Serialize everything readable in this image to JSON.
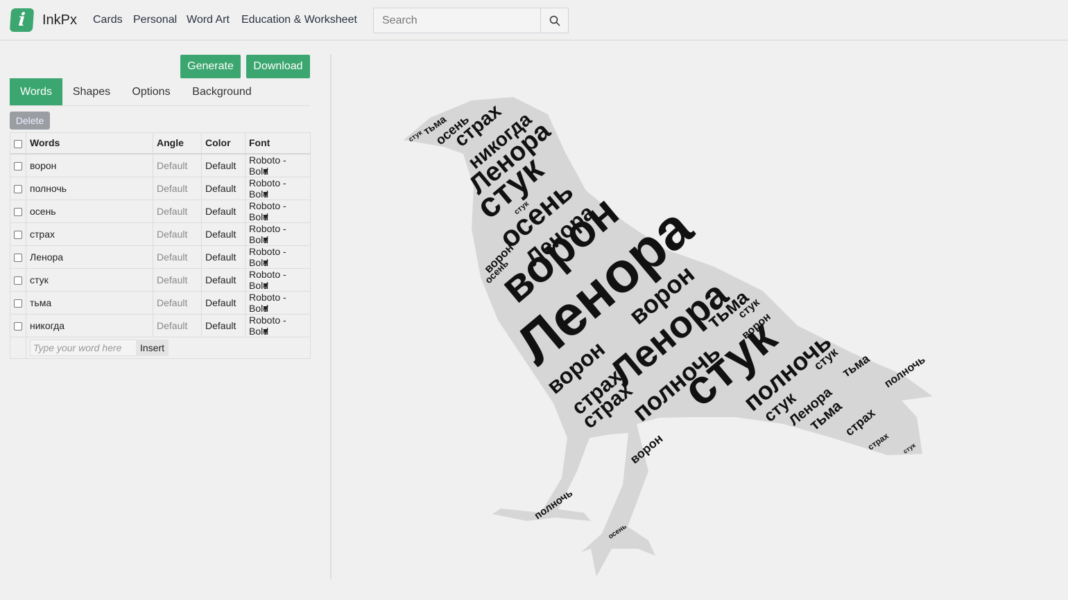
{
  "brand": "InkPx",
  "nav": [
    "Cards",
    "Personal",
    "Word Art",
    "Education & Worksheet"
  ],
  "search": {
    "placeholder": "Search",
    "icon": "search-icon"
  },
  "actions": {
    "generate": "Generate",
    "download": "Download"
  },
  "tabs": [
    "Words",
    "Shapes",
    "Options",
    "Background"
  ],
  "active_tab": "Words",
  "delete_label": "Delete",
  "table": {
    "headers": [
      "Words",
      "Angle",
      "Color",
      "Font"
    ],
    "rows": [
      {
        "word": "ворон",
        "angle": "Default",
        "color": "Default",
        "font": "Roboto - Bold"
      },
      {
        "word": "полночь",
        "angle": "Default",
        "color": "Default",
        "font": "Roboto - Bold"
      },
      {
        "word": "осень",
        "angle": "Default",
        "color": "Default",
        "font": "Roboto - Bold"
      },
      {
        "word": "страх",
        "angle": "Default",
        "color": "Default",
        "font": "Roboto - Bold"
      },
      {
        "word": "Ленора",
        "angle": "Default",
        "color": "Default",
        "font": "Roboto - Bold"
      },
      {
        "word": "стук",
        "angle": "Default",
        "color": "Default",
        "font": "Roboto - Bold"
      },
      {
        "word": "тьма",
        "angle": "Default",
        "color": "Default",
        "font": "Roboto - Bold"
      },
      {
        "word": "никогда",
        "angle": "Default",
        "color": "Default",
        "font": "Roboto - Bold"
      }
    ],
    "new_word_placeholder": "Type your word here",
    "insert_label": "Insert"
  },
  "cloud": {
    "shape_color": "#d6d6d6",
    "words": [
      "стук",
      "тьма",
      "осень",
      "страх",
      "никогда",
      "Ленора",
      "стук",
      "стук",
      "осень",
      "Ленора",
      "ворон",
      "ворон",
      "осень",
      "Ленора",
      "ворон",
      "Ленора",
      "ворон",
      "тьма",
      "ворон",
      "страх",
      "полночь",
      "стук",
      "полночь",
      "страх",
      "стук",
      "Ленора",
      "тьма",
      "стук",
      "страх",
      "полночь",
      "тьма",
      "страх",
      "полночь",
      "осень",
      "ворон",
      "стук",
      "стук"
    ]
  }
}
